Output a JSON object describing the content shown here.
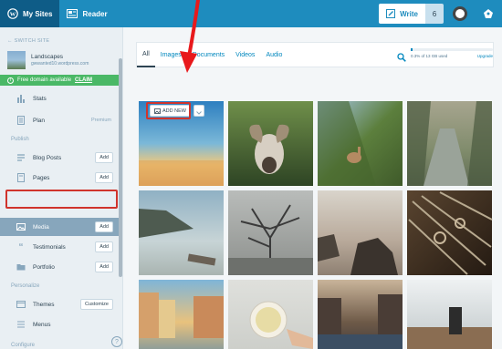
{
  "topbar": {
    "my_sites": "My Sites",
    "reader": "Reader",
    "write": "Write",
    "write_count": "6"
  },
  "sidebar": {
    "switch_site": "← SWITCH SITE",
    "site_name": "Landscapes",
    "site_url": "gwwanted10.wordpress.com",
    "domain_text": "Free domain available",
    "domain_claim": "CLAIM",
    "items": [
      {
        "label": "Stats"
      },
      {
        "label": "Plan",
        "tag": "Premium"
      },
      {
        "label": "Blog Posts",
        "action": "Add"
      },
      {
        "label": "Pages",
        "action": "Add"
      },
      {
        "label": "Media",
        "action": "Add"
      },
      {
        "label": "Testimonials",
        "action": "Add"
      },
      {
        "label": "Portfolio",
        "action": "Add"
      },
      {
        "label": "Themes",
        "action": "Customize"
      },
      {
        "label": "Menus"
      }
    ],
    "sections": {
      "publish": "Publish",
      "personalize": "Personalize",
      "configure": "Configure"
    },
    "help": "?"
  },
  "media": {
    "tabs": [
      "All",
      "Images",
      "Documents",
      "Videos",
      "Audio"
    ],
    "storage_text": "0.3% of 13 GB used",
    "storage_upgrade": "Upgrade",
    "storage_fraction": 0.003,
    "add_new": "ADD NEW"
  },
  "colors": {
    "topbar": "#1e8cbe",
    "accent": "#0087be",
    "highlight": "#d0342c",
    "domain_green": "#4ab866"
  }
}
